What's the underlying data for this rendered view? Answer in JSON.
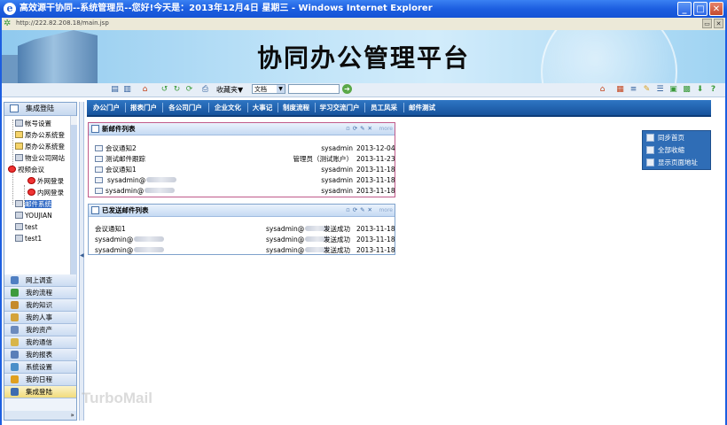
{
  "window": {
    "title": "高效源干协同--系统管理员--您好!今天是：2013年12月4日 星期三 - Windows Internet Explorer",
    "url": "http://222.82.208.18/main.jsp"
  },
  "header": {
    "site_title": "协同办公管理平台"
  },
  "toolbar": {
    "favorites_label": "收藏夹▼",
    "doc_select_value": "文档"
  },
  "left_panel": {
    "header": "集成登陆",
    "tree": [
      {
        "label": "帐号设置",
        "icon": "doc-edit-icon"
      },
      {
        "label": "原办公系统登",
        "icon": "folder-icon"
      },
      {
        "label": "原办公系统登",
        "icon": "key-icon"
      },
      {
        "label": "物业公司网站",
        "icon": "doc-icon"
      },
      {
        "label": "视频会议",
        "icon": "video-icon"
      },
      {
        "label": "外网登录",
        "icon": "video-icon"
      },
      {
        "label": "内网登录",
        "icon": "video-icon"
      },
      {
        "label": "邮件系统",
        "icon": "mail-icon"
      },
      {
        "label": "YOUJIAN",
        "icon": "doc-icon"
      },
      {
        "label": "test",
        "icon": "doc-icon"
      },
      {
        "label": "test1",
        "icon": "doc-icon"
      }
    ],
    "nav": [
      {
        "label": "网上调查",
        "color": "#4f7fc2"
      },
      {
        "label": "我的流程",
        "color": "#3d9a3d"
      },
      {
        "label": "我的知识",
        "color": "#c58a2b"
      },
      {
        "label": "我的人事",
        "color": "#d4a33a"
      },
      {
        "label": "我的资产",
        "color": "#6c8bbd"
      },
      {
        "label": "我的通信",
        "color": "#d8b54a"
      },
      {
        "label": "我的报表",
        "color": "#5a7fb8"
      },
      {
        "label": "系统设置",
        "color": "#4a8fc9"
      },
      {
        "label": "我的日程",
        "color": "#e0a020"
      },
      {
        "label": "集成登陆",
        "color": "#3e6cb0"
      }
    ],
    "foot": "»"
  },
  "tabs": [
    "办公门户",
    "报表门户",
    "各公司门户",
    "企业文化",
    "大事记",
    "制度流程",
    "学习交流门户",
    "员工风采",
    "邮件测试"
  ],
  "inbox": {
    "title": "新邮件列表",
    "more": "more",
    "rows": [
      {
        "subject": "会议通知2",
        "from": "sysadmin",
        "date": "2013-12-04",
        "icon": "mail-icon"
      },
      {
        "subject": "测试邮件跟踪",
        "from": "管理员（测试账户）",
        "date": "2013-11-23",
        "icon": "mail-open-icon"
      },
      {
        "subject": "会议通知1",
        "from": "sysadmin",
        "date": "2013-11-18",
        "icon": "mail-open-icon"
      },
      {
        "subject": "sysadmin@",
        "from": "sysadmin",
        "date": "2013-11-18",
        "icon": "mail-icon"
      },
      {
        "subject": "sysadmin@",
        "from": "sysadmin",
        "date": "2013-11-18",
        "icon": "mail-open-icon"
      }
    ]
  },
  "sent": {
    "title": "已发送邮件列表",
    "more": "more",
    "rows": [
      {
        "subject": "会议通知1",
        "to": "sysadmin@",
        "status": "发送成功",
        "date": "2013-11-18"
      },
      {
        "subject": "sysadmin@",
        "to": "sysadmin@",
        "status": "发送成功",
        "date": "2013-11-18"
      },
      {
        "subject": "sysadmin@",
        "to": "sysadmin@",
        "status": "发送成功",
        "date": "2013-11-18"
      }
    ]
  },
  "quick_links": [
    "同步首页",
    "全部收缩",
    "显示页面地址"
  ],
  "watermark": "TurboMail"
}
